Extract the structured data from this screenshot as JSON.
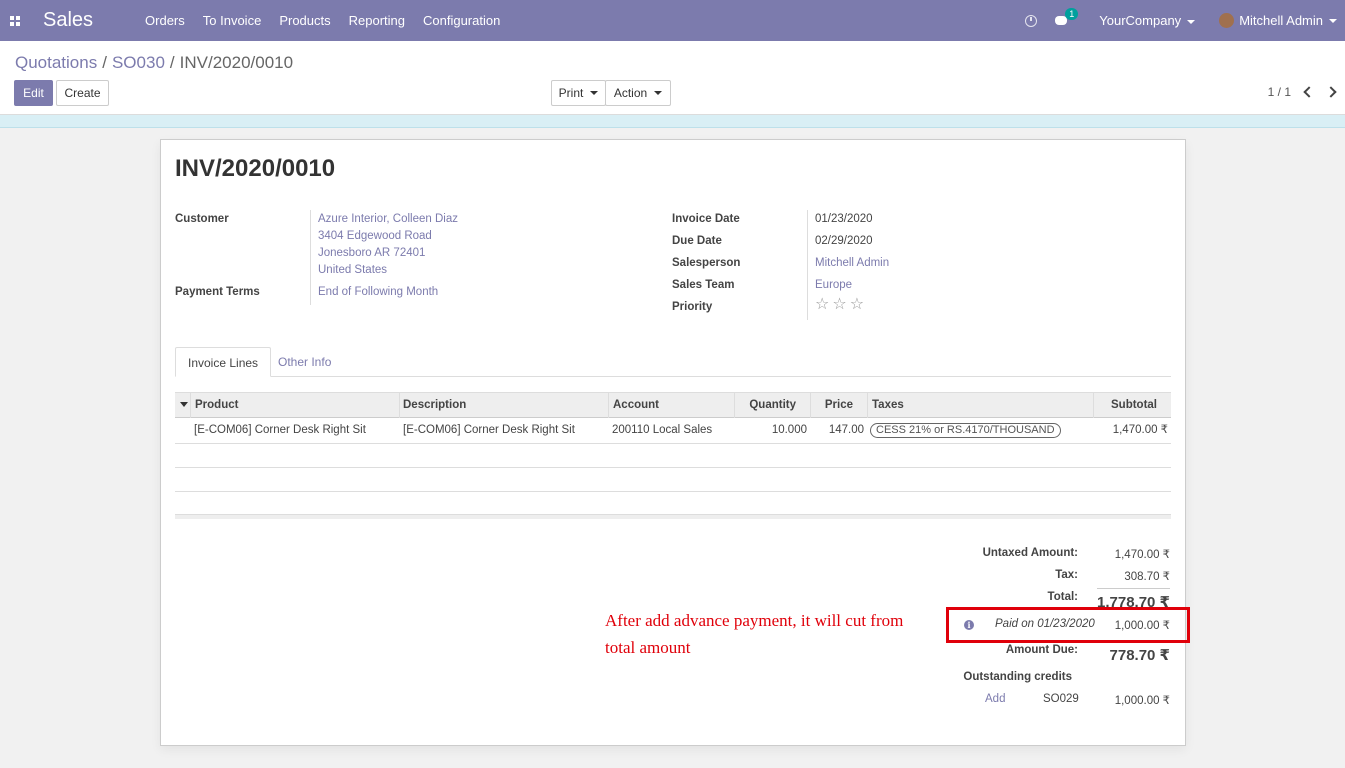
{
  "navbar": {
    "brand": "Sales",
    "menu": [
      "Orders",
      "To Invoice",
      "Products",
      "Reporting",
      "Configuration"
    ],
    "chat_badge": "1",
    "company": "YourCompany",
    "user": "Mitchell Admin"
  },
  "breadcrumb": {
    "items": [
      "Quotations",
      "SO030"
    ],
    "separator": "/",
    "current": "INV/2020/0010"
  },
  "toolbar": {
    "edit_label": "Edit",
    "create_label": "Create",
    "print_label": "Print",
    "action_label": "Action"
  },
  "pager": {
    "value": "1 / 1"
  },
  "invoice": {
    "title": "INV/2020/0010",
    "customer_label": "Customer",
    "customer_lines": [
      "Azure Interior, Colleen Diaz",
      "3404 Edgewood Road",
      "Jonesboro AR 72401",
      "United States"
    ],
    "payment_terms_label": "Payment Terms",
    "payment_terms": "End of Following Month",
    "invoice_date_label": "Invoice Date",
    "invoice_date": "01/23/2020",
    "due_date_label": "Due Date",
    "due_date": "02/29/2020",
    "salesperson_label": "Salesperson",
    "salesperson": "Mitchell Admin",
    "sales_team_label": "Sales Team",
    "sales_team": "Europe",
    "priority_label": "Priority",
    "priority_stars": 0
  },
  "tabs": [
    "Invoice Lines",
    "Other Info"
  ],
  "lines_table": {
    "columns": [
      "Product",
      "Description",
      "Account",
      "Quantity",
      "Price",
      "Taxes",
      "Subtotal"
    ],
    "rows": [
      {
        "product": "[E-COM06] Corner Desk Right Sit",
        "description": "[E-COM06] Corner Desk Right Sit",
        "account": "200110 Local Sales",
        "quantity": "10.000",
        "price": "147.00",
        "taxes": "CESS 21% or RS.4170/THOUSAND",
        "subtotal": "1,470.00 ₹"
      }
    ]
  },
  "totals": {
    "untaxed_label": "Untaxed Amount:",
    "untaxed_value": "1,470.00 ₹",
    "tax_label": "Tax:",
    "tax_value": "308.70 ₹",
    "total_label": "Total:",
    "total_value": "1,778.70 ₹",
    "paid_text": "Paid on 01/23/2020",
    "paid_value": "1,000.00 ₹",
    "amount_due_label": "Amount Due:",
    "amount_due_value": "778.70 ₹",
    "outstanding_label": "Outstanding credits",
    "credit_add_label": "Add",
    "credit_ref": "SO029",
    "credit_value": "1,000.00 ₹"
  },
  "annotation": {
    "text": "After add advance payment, it will cut from total amount",
    "color": "#e0000a"
  },
  "colors": {
    "brand": "#7c7bad",
    "accent_badge": "#00a09d"
  }
}
